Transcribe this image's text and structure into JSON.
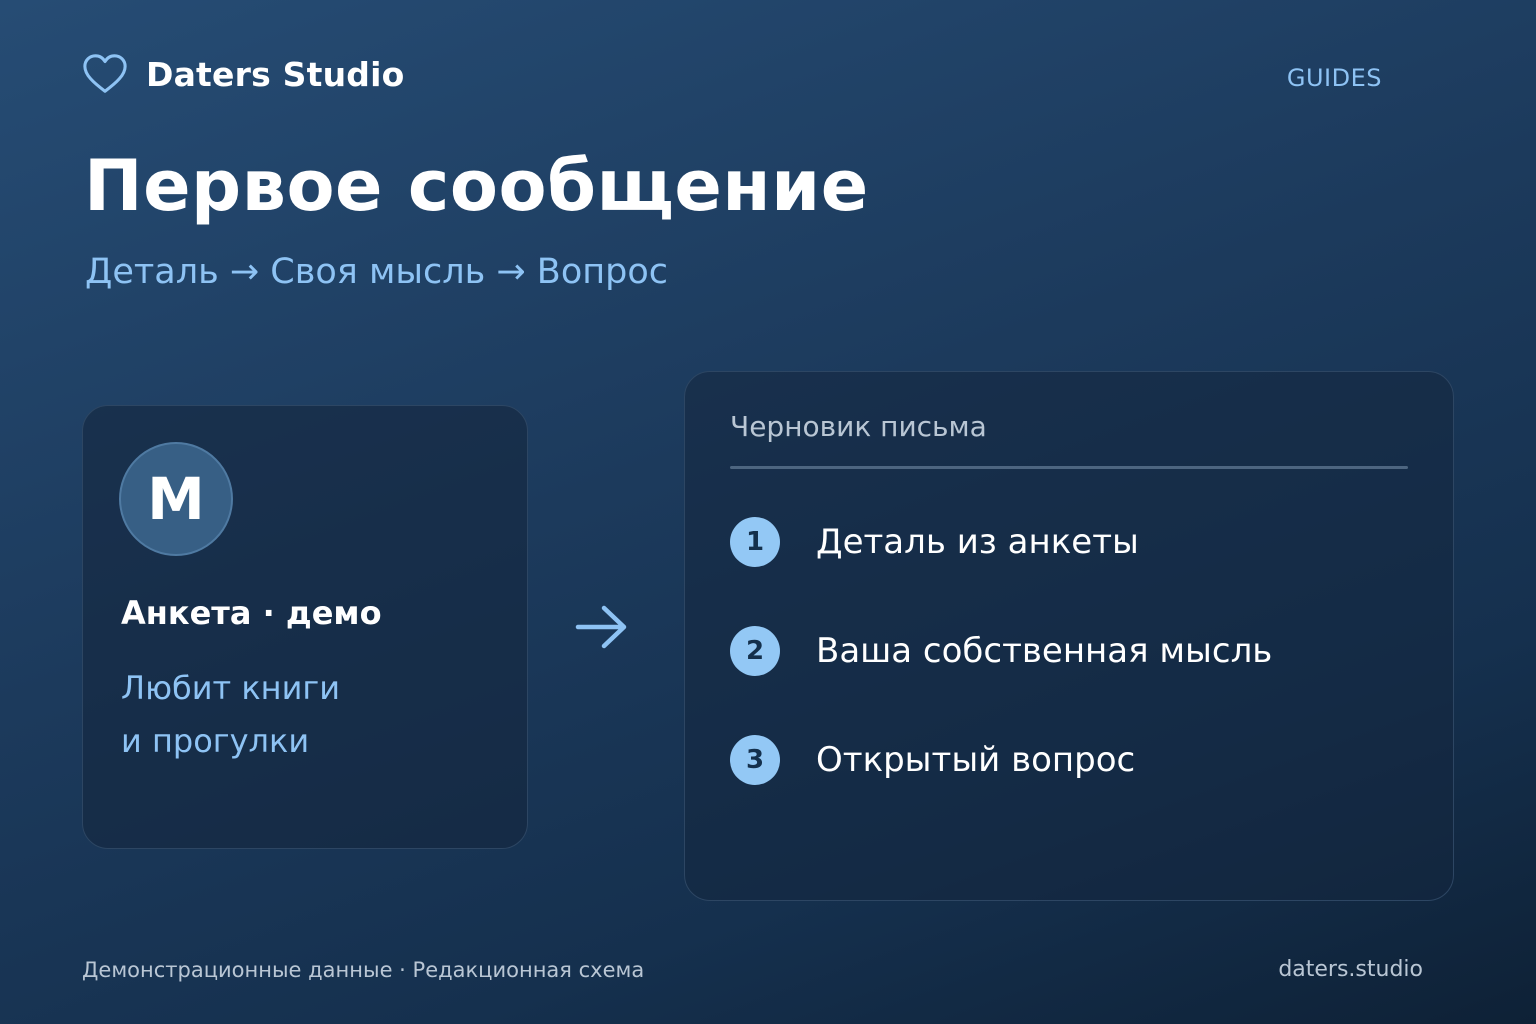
{
  "brand": {
    "name": "Daters Studio",
    "icon": "heart-outline-icon"
  },
  "nav": {
    "guides": "GUIDES"
  },
  "header": {
    "title": "Первое сообщение",
    "subtitle": "Деталь → Своя мысль → Вопрос"
  },
  "profile_card": {
    "avatar_letter": "М",
    "label": "Анкета · демо",
    "detail_line1": "Любит книги",
    "detail_line2": "и прогулки"
  },
  "flow_arrow": {
    "icon": "arrow-right-icon"
  },
  "draft_card": {
    "title": "Черновик письма",
    "steps": [
      {
        "number": "1",
        "label": "Деталь из анкеты"
      },
      {
        "number": "2",
        "label": "Ваша собственная мысль"
      },
      {
        "number": "3",
        "label": "Открытый вопрос"
      }
    ]
  },
  "footer": {
    "note": "Демонстрационные данные · Редакционная схема",
    "site": "daters.studio"
  },
  "colors": {
    "accent": "#8ec3f4",
    "badge": "#93c8f5",
    "text_primary": "#ffffff",
    "text_muted": "#b9c6d4"
  }
}
